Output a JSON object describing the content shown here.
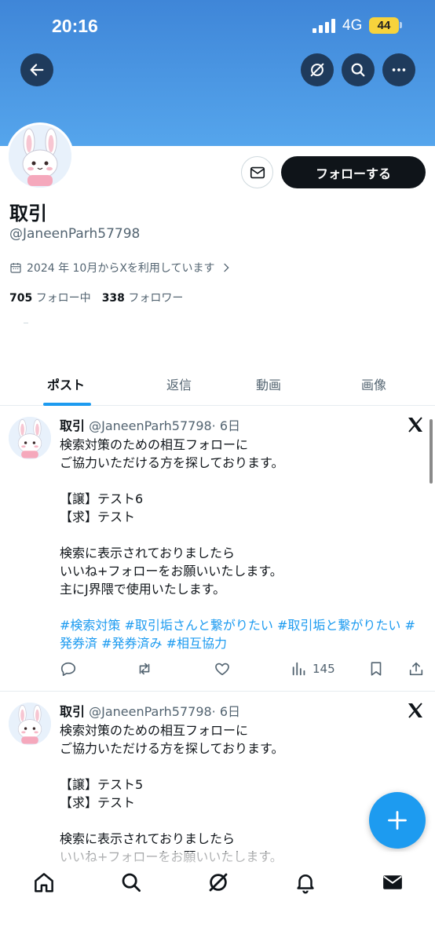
{
  "status_bar": {
    "time": "20:16",
    "network": "4G",
    "battery": "44"
  },
  "profile": {
    "name": "取引",
    "handle": "@JaneenParh57798",
    "joined": "2024 年 10月からXを利用しています",
    "following_count": "705",
    "following_label": "フォロー中",
    "followers_count": "338",
    "followers_label": "フォロワー",
    "follow_button": "フォローする"
  },
  "tabs": [
    {
      "label": "ポスト",
      "active": true
    },
    {
      "label": "返信",
      "active": false
    },
    {
      "label": "動画",
      "active": false
    },
    {
      "label": "画像",
      "active": false
    }
  ],
  "tweets": [
    {
      "name": "取引",
      "handle": "@JaneenParh57798",
      "time": "· 6日",
      "lines": [
        "検索対策のための相互フォローに",
        "ご協力いただける方を探しております。",
        "",
        "【譲】テスト6",
        "【求】テスト",
        "",
        "検索に表示されておりましたら",
        "いいね+フォローをお願いいたします。",
        "主にJ界隈で使用いたします。",
        ""
      ],
      "tags_line1": "#検索対策 #取引垢さんと繋がりたい #取引垢と繋がりたい #",
      "tags_line2": "発券済 #発券済み #相互協力",
      "views": "145"
    },
    {
      "name": "取引",
      "handle": "@JaneenParh57798",
      "time": "· 6日",
      "lines": [
        "検索対策のための相互フォローに",
        "ご協力いただける方を探しております。",
        "",
        "【譲】テスト5",
        "【求】テスト",
        "",
        "検索に表示されておりましたら",
        "いいね+フォローをお願いいたします。"
      ]
    }
  ],
  "colors": {
    "accent": "#1d9bf0",
    "banner": "#4a97e2",
    "text": "#0f1419",
    "muted": "#536471"
  }
}
